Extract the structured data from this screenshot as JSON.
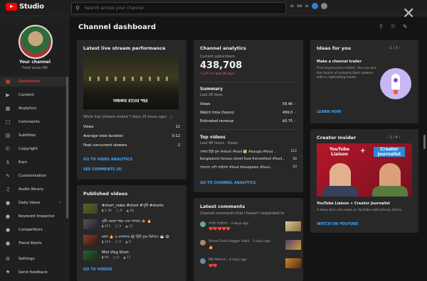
{
  "header": {
    "logo_text": "Studio",
    "search_placeholder": "Search across your channel",
    "tray": [
      "6k",
      "384",
      "4h"
    ]
  },
  "sidebar": {
    "channel_label": "Your channel",
    "channel_name": "Food Lover BK",
    "items": [
      {
        "label": "Dashboard",
        "icon": "dashboard-icon"
      },
      {
        "label": "Content",
        "icon": "content-icon"
      },
      {
        "label": "Analytics",
        "icon": "analytics-icon"
      },
      {
        "label": "Comments",
        "icon": "comments-icon"
      },
      {
        "label": "Subtitles",
        "icon": "subtitles-icon"
      },
      {
        "label": "Copyright",
        "icon": "copyright-icon"
      },
      {
        "label": "Earn",
        "icon": "earn-icon"
      },
      {
        "label": "Customisation",
        "icon": "customisation-icon"
      },
      {
        "label": "Audio library",
        "icon": "audio-library-icon"
      },
      {
        "label": "Daily Ideas",
        "icon": "daily-ideas-icon"
      },
      {
        "label": "Keyword Inspector",
        "icon": "keyword-icon"
      },
      {
        "label": "Competitors",
        "icon": "competitors-icon"
      },
      {
        "label": "Trend Alerts",
        "icon": "trend-icon"
      }
    ],
    "settings_label": "Settings",
    "feedback_label": "Send feedback"
  },
  "page_title": "Channel dashboard",
  "live": {
    "title": "Latest live stream performance",
    "thumb_caption": "অন্ধকার রাতের শহর",
    "meta": "While live (stream ended 7 days 15 hours ago)",
    "rows": [
      {
        "label": "Views",
        "value": "12"
      },
      {
        "label": "Average view duration",
        "value": "0:12"
      },
      {
        "label": "Peak concurrent viewers",
        "value": "2"
      }
    ],
    "link_analytics": "GO TO VIDEO ANALYTICS",
    "link_comments": "SEE COMMENTS (0)"
  },
  "published": {
    "title": "Published videos",
    "videos": [
      {
        "title": "#short_video #short #পুষ্টি #shorts",
        "views": "2.3K",
        "comments": "0",
        "likes": "40"
      },
      {
        "title": "বৃষ্টি ভেজা শহর এবং খাবার 🍲 🔥",
        "views": "451",
        "comments": "3",
        "likes": "21"
      },
      {
        "title": "ঝাল 🔥 ও মজাদার 😋 স্ট্রিট ফুড ভিডিও 🍜 😋",
        "views": "241",
        "comments": "0",
        "likes": "9"
      },
      {
        "title": "Mini Vlog Short",
        "views": "99",
        "comments": "0",
        "likes": "11"
      }
    ],
    "link": "GO TO VIDEOS"
  },
  "analytics": {
    "title": "Channel analytics",
    "subs_label": "Current subscribers",
    "subs_value": "438,708",
    "subs_change": "-1,277 in last 28 days",
    "summary_title": "Summary",
    "summary_period": "Last 28 days",
    "summary_rows": [
      {
        "label": "Views",
        "value": "58.4K"
      },
      {
        "label": "Watch time (hours)",
        "value": "499.0"
      },
      {
        "label": "Estimated revenue",
        "value": "$0.75"
      }
    ],
    "top_title": "Top videos",
    "top_period": "Last 48 hours · Views",
    "top_rows": [
      {
        "label": "ঢাকার স্ট্রিট ফুড #short #food ✅ #bangla #food...",
        "value": "112"
      },
      {
        "label": "Bangladeshi famous street food #streetfood #food...",
        "value": "50"
      },
      {
        "label": "সবচেয়ে বেশি ভাইরাল #food #foodphoto #food...",
        "value": "23"
      }
    ],
    "link": "GO TO CHANNEL ANALYTICS"
  },
  "comments": {
    "title": "Latest comments",
    "subtitle": "Channel comments that I haven't responded to",
    "items": [
      {
        "author": "ফাহিম ভাইয়াযা · 3 days ago",
        "text": "❤️❤️❤️❤️❤️"
      },
      {
        "author": "Street Food Vlogger Sabir · 3 days ago",
        "text": "👍"
      },
      {
        "author": "MD Mohsin · 4 days ago",
        "text": "❤️❤️"
      }
    ]
  },
  "ideas": {
    "title": "Ideas for you",
    "pager": "1 / 3",
    "heading": "Make a channel trailer",
    "body": "First impressions matter. You can win the hearts of unsubscribed viewers with a captivating trailer.",
    "link": "LEARN HOW"
  },
  "insider": {
    "title": "Creator Insider",
    "pager": "1 / 4",
    "thumb_left": "YouTube Liaison",
    "thumb_plus": "+",
    "thumb_right": "Creator Journalist",
    "heading": "YouTube Liaison + Creator Journalist",
    "body": "A deep dive into news on YouTube with Johnny Harris",
    "link": "WATCH ON YOUTUBE"
  }
}
